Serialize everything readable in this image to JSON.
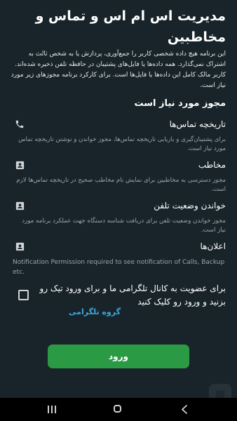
{
  "header": {
    "title": "مدیریت اس ام اس و تماس و مخاطبین"
  },
  "intro": "این برنامه هیچ داده شخصی کاربر را جمع‌آوری، پردازش یا به شخص ثالث به اشتراک نمی‌گذارد. همه داده‌ها یا فایل‌های پشتیبان در حافظه تلفن ذخیره شده‌اند. کاربر مالک کامل این داده‌ها یا فایل‌ها است. برای کارکرد برنامه مجوزهای زیر مورد نیاز است.",
  "section_title": "مجوز مورد نیاز است",
  "permissions": [
    {
      "name": "تاریخچه تماس‌ها",
      "icon": "phone-icon",
      "desc": "برای پشتیبان‌گیری و بازیابی تاریخچه تماس‌ها، مجوز خواندن و نوشتن تاریخچه تماس مورد نیاز است."
    },
    {
      "name": "مخاطب",
      "icon": "contact-card-icon",
      "desc": "مجوز دسترسی به مخاطبین برای نمایش نام مخاطب صحیح در تاریخچه تماس‌ها لازم است."
    },
    {
      "name": "خواندن وضعیت تلفن",
      "icon": "contact-card-icon",
      "desc": "مجوز خواندن وضعیت تلفن برای دریافت شناسه دستگاه جهت عملکرد برنامه مورد نیاز است."
    },
    {
      "name": "اعلان‌ها",
      "icon": "contact-card-icon",
      "desc": "Notification Permission required to see notification of Calls, Backup etc."
    }
  ],
  "channel": {
    "text": "برای عضویت به کانال تلگرامی ما و برای ورود تیک رو بزنید و ورود رو کلیک کنید",
    "link": "گروه تلگرامی",
    "checked": false
  },
  "login_button": "ورود",
  "colors": {
    "background": "#18242a",
    "button": "#2a9a45",
    "link": "#3ea6d8",
    "muted_text": "#9aa5aa"
  }
}
